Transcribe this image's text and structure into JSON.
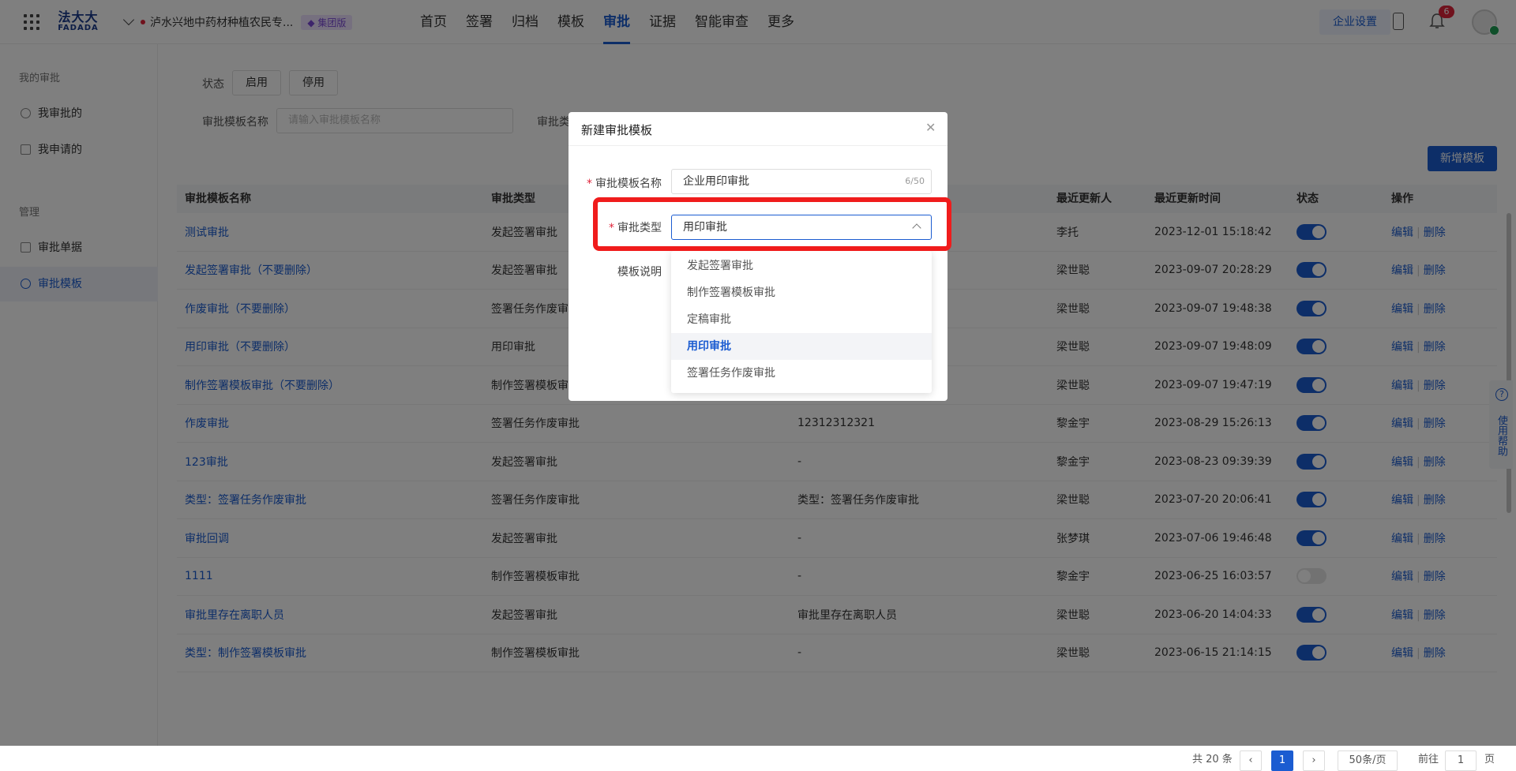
{
  "header": {
    "logo_cn": "法大大",
    "logo_en": "FADADA",
    "org_name": "泸水兴地中药材种植农民专...",
    "org_badge": "集团版",
    "nav": [
      "首页",
      "签署",
      "归档",
      "模板",
      "审批",
      "证据",
      "智能审查",
      "更多"
    ],
    "active_nav": "审批",
    "enterprise_settings": "企业设置",
    "notification_count": "6"
  },
  "sidebar": {
    "section1": "我的审批",
    "items1": [
      "我审批的",
      "我申请的"
    ],
    "section2": "管理",
    "items2": [
      "审批单据",
      "审批模板"
    ],
    "active": "审批模板"
  },
  "filters": {
    "status_label": "状态",
    "enable": "启用",
    "disable": "停用",
    "name_label": "审批模板名称",
    "name_placeholder": "请输入审批模板名称",
    "type_label": "审批类"
  },
  "add_button": "新增模板",
  "table": {
    "headers": [
      "审批模板名称",
      "审批类型",
      "",
      "最近更新人",
      "最近更新时间",
      "状态",
      "操作"
    ],
    "rows": [
      {
        "name": "测试审批",
        "type": "发起签署审批",
        "desc": "",
        "updater": "李托",
        "time": "2023-12-01 15:18:42",
        "on": true
      },
      {
        "name": "发起签署审批（不要删除）",
        "type": "发起签署审批",
        "desc": "",
        "updater": "梁世聪",
        "time": "2023-09-07 20:28:29",
        "on": true
      },
      {
        "name": "作废审批（不要删除）",
        "type": "签署任务作废审",
        "desc": "",
        "updater": "梁世聪",
        "time": "2023-09-07 19:48:38",
        "on": true
      },
      {
        "name": "用印审批（不要删除）",
        "type": "用印审批",
        "desc": "",
        "updater": "梁世聪",
        "time": "2023-09-07 19:48:09",
        "on": true
      },
      {
        "name": "制作签署模板审批（不要删除）",
        "type": "制作签署模板审",
        "desc": "",
        "updater": "梁世聪",
        "time": "2023-09-07 19:47:19",
        "on": true
      },
      {
        "name": "作废审批",
        "type": "签署任务作废审批",
        "desc": "12312312321",
        "updater": "黎金宇",
        "time": "2023-08-29 15:26:13",
        "on": true
      },
      {
        "name": "123审批",
        "type": "发起签署审批",
        "desc": "-",
        "updater": "黎金宇",
        "time": "2023-08-23 09:39:39",
        "on": true
      },
      {
        "name": "类型：签署任务作废审批",
        "type": "签署任务作废审批",
        "desc": "类型：签署任务作废审批",
        "updater": "梁世聪",
        "time": "2023-07-20 20:06:41",
        "on": true
      },
      {
        "name": "审批回调",
        "type": "发起签署审批",
        "desc": "-",
        "updater": "张梦琪",
        "time": "2023-07-06 19:46:48",
        "on": true
      },
      {
        "name": "1111",
        "type": "制作签署模板审批",
        "desc": "-",
        "updater": "黎金宇",
        "time": "2023-06-25 16:03:57",
        "on": false
      },
      {
        "name": "审批里存在离职人员",
        "type": "发起签署审批",
        "desc": "审批里存在离职人员",
        "updater": "梁世聪",
        "time": "2023-06-20 14:04:33",
        "on": true
      },
      {
        "name": "类型：制作签署模板审批",
        "type": "制作签署模板审批",
        "desc": "-",
        "updater": "梁世聪",
        "time": "2023-06-15 21:14:15",
        "on": true
      }
    ],
    "edit": "编辑",
    "delete": "删除"
  },
  "pagination": {
    "total": "共 20 条",
    "page": "1",
    "page_size": "50条/页",
    "goto_label": "前往",
    "goto_value": "1",
    "page_unit": "页"
  },
  "help": "使用帮助",
  "modal": {
    "title": "新建审批模板",
    "name_label": "审批模板名称",
    "name_value": "企业用印审批",
    "name_count": "6/50",
    "type_label": "审批类型",
    "type_value": "用印审批",
    "desc_label": "模板说明",
    "options": [
      "发起签署审批",
      "制作签署模板审批",
      "定稿审批",
      "用印审批",
      "签署任务作废审批"
    ],
    "selected_option": "用印审批"
  }
}
